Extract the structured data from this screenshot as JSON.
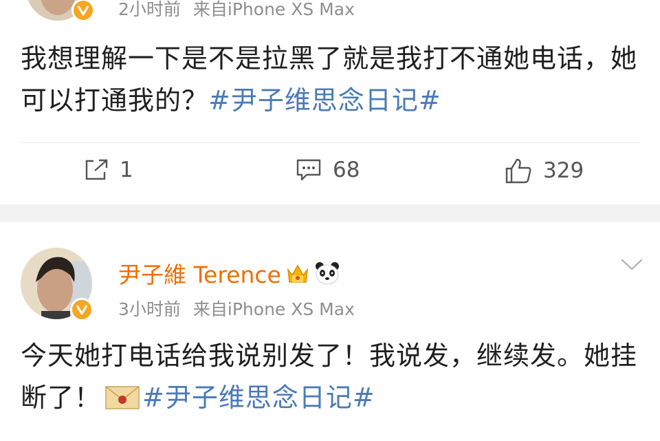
{
  "post1": {
    "meta_time": "2小时前",
    "meta_source": "来自iPhone XS Max",
    "content_text": "我想理解一下是不是拉黑了就是我打不通她电话，她可以打通我的？",
    "hashtag": "#尹子维思念日记#",
    "actions": {
      "repost_count": "1",
      "comment_count": "68",
      "like_count": "329"
    }
  },
  "post2": {
    "username": "尹子維 Terence",
    "meta_time": "3小时前",
    "meta_source": "来自iPhone XS Max",
    "content_text": "今天她打电话给我说别发了！我说发，继续发。她挂断了！",
    "hashtag": "#尹子维思念日记#"
  },
  "colors": {
    "username": "#f26d00",
    "hashtag": "#4a7ab8",
    "meta": "#8e8e8e",
    "separator": "#f2f2f2",
    "verified_badge": "#f5a623"
  },
  "icons": [
    "verified-badge-icon",
    "repost-icon",
    "comment-icon",
    "like-icon",
    "crown-icon",
    "panda-emoji-icon",
    "envelope-emoji-icon",
    "chevron-down-icon"
  ]
}
